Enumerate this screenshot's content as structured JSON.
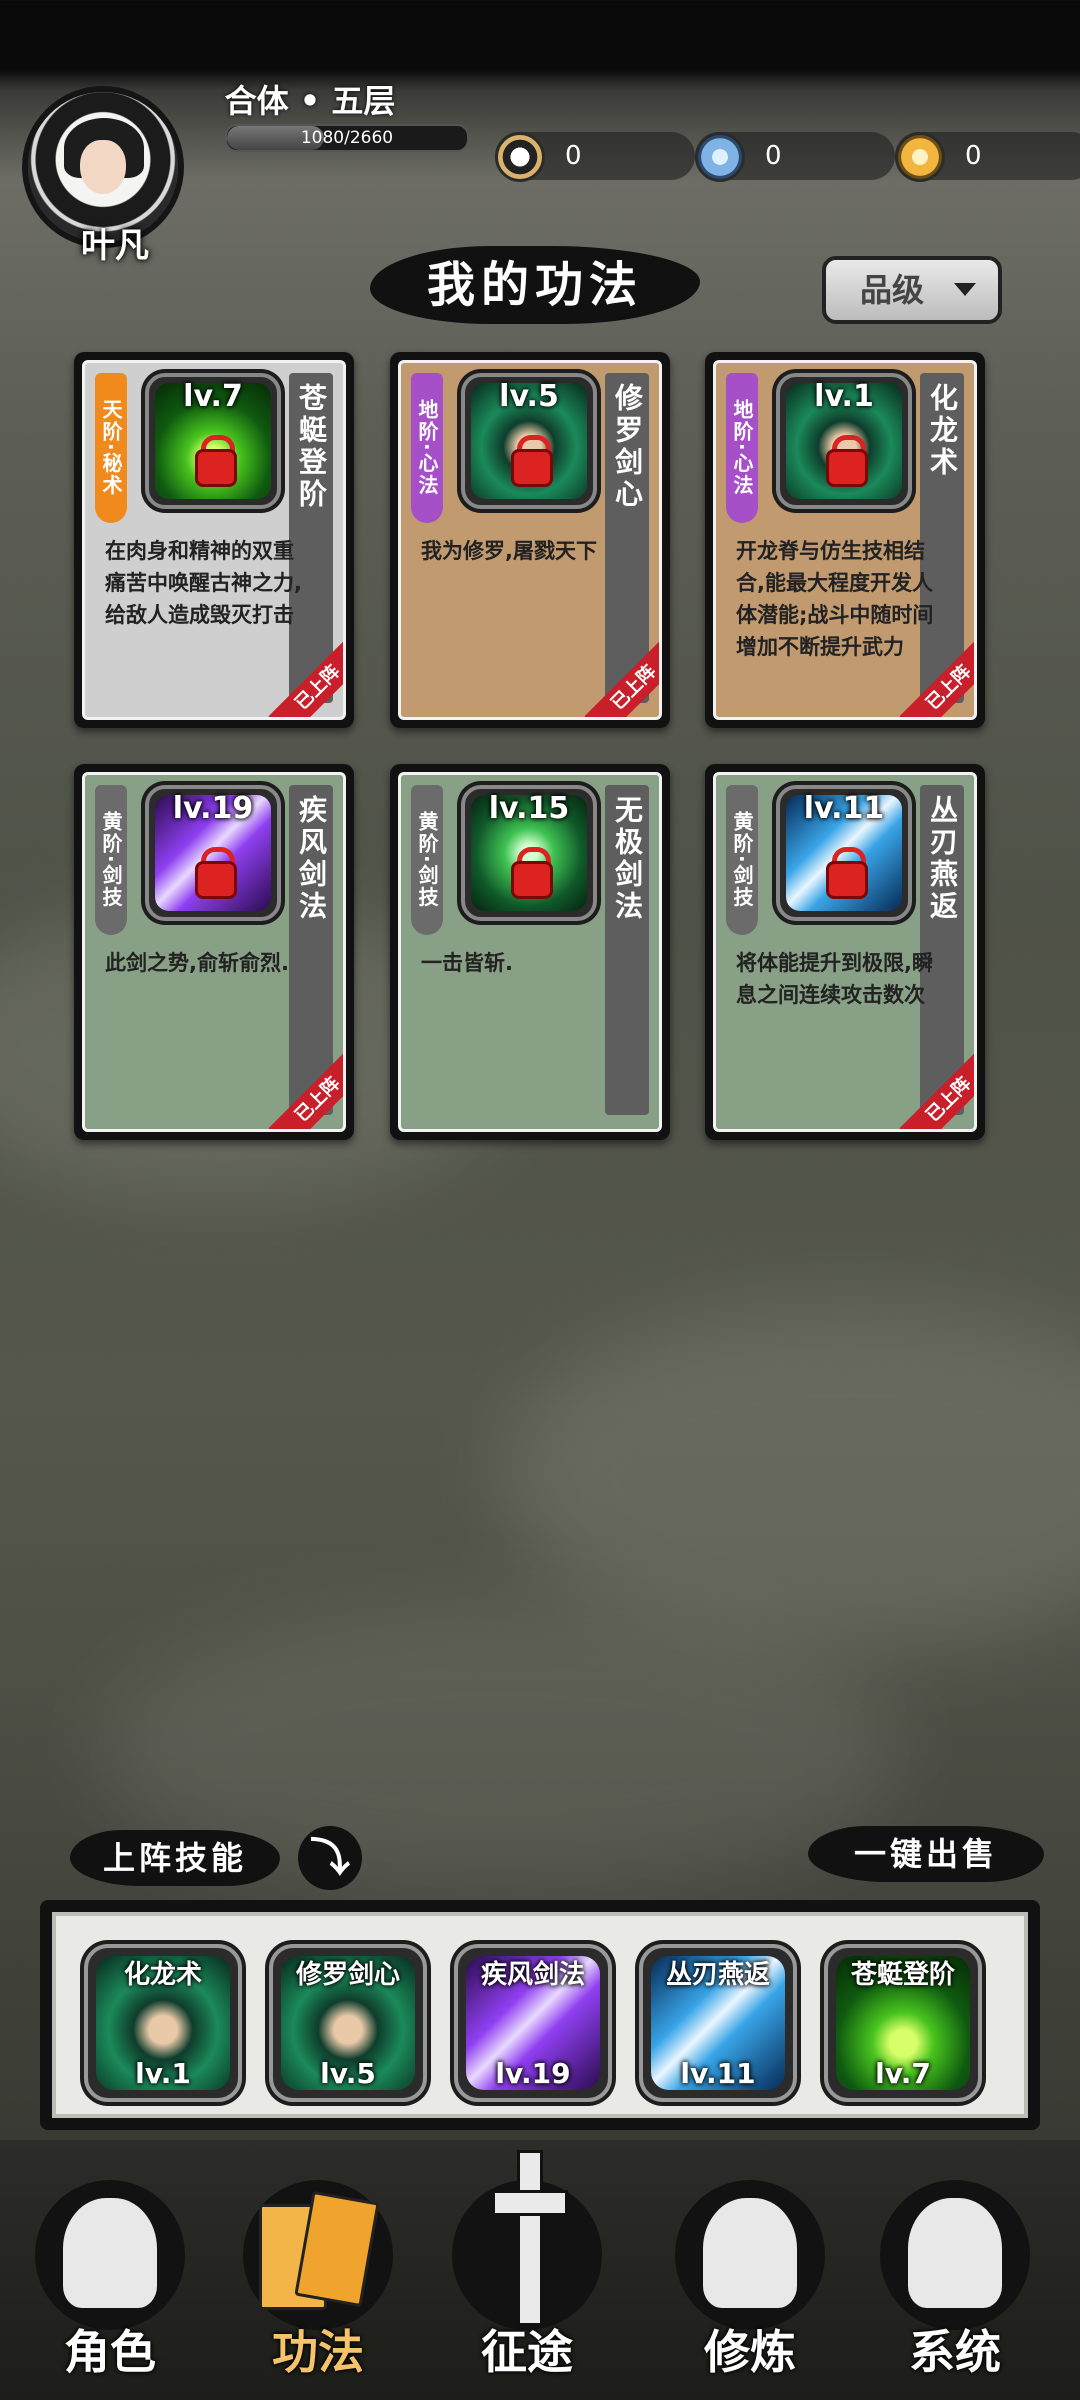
{
  "player": {
    "name": "叶凡",
    "realm": "合体 • 五层",
    "exp_text": "1080/2660",
    "exp_current": 1080,
    "exp_max": 2660
  },
  "resources": [
    {
      "icon": "yin-yang-icon",
      "value": "0",
      "color": "#d9b36a"
    },
    {
      "icon": "crystal-icon",
      "value": "0",
      "color": "#7fb3e6"
    },
    {
      "icon": "lightning-icon",
      "value": "0",
      "color": "#f2b640"
    }
  ],
  "title": "我的功法",
  "sort_button": {
    "label": "品级"
  },
  "cards": [
    {
      "grade": "天阶·秘术",
      "grade_color": "#f08a1c",
      "level": "lv.7",
      "name": "苍蜓登阶",
      "desc": "在肉身和精神的双重痛苦中唤醒古神之力,给敌人造成毁灭打击",
      "equipped": "已上阵",
      "bg": "gray",
      "art": "green-fire"
    },
    {
      "grade": "地阶·心法",
      "grade_color": "#a54fc9",
      "level": "lv.5",
      "name": "修罗剑心",
      "desc": "我为修罗,屠戮天下",
      "equipped": "已上阵",
      "bg": "tan",
      "art": "hooded"
    },
    {
      "grade": "地阶·心法",
      "grade_color": "#a54fc9",
      "level": "lv.1",
      "name": "化龙术",
      "desc": "开龙脊与仿生技相结合,能最大程度开发人体潜能;战斗中随时间增加不断提升武力",
      "equipped": "已上阵",
      "bg": "tan",
      "art": "hooded"
    },
    {
      "grade": "黄阶·剑技",
      "grade_color": "#6b6b6b",
      "level": "lv.19",
      "name": "疾风剑法",
      "desc": "此剑之势,俞斩俞烈.",
      "equipped": "已上阵",
      "bg": "green",
      "art": "purple-slash"
    },
    {
      "grade": "黄阶·剑技",
      "grade_color": "#6b6b6b",
      "level": "lv.15",
      "name": "无极剑法",
      "desc": "一击皆斩.",
      "equipped": "",
      "bg": "green",
      "art": "green-burst"
    },
    {
      "grade": "黄阶·剑技",
      "grade_color": "#6b6b6b",
      "level": "lv.11",
      "name": "丛刃燕返",
      "desc": "将体能提升到极限,瞬息之间连续攻击数次",
      "equipped": "已上阵",
      "bg": "green",
      "art": "blue-slash"
    }
  ],
  "equipped_section": {
    "label": "上阵技能",
    "sell_label": "一键出售"
  },
  "slots": [
    {
      "name": "化龙术",
      "level": "lv.1",
      "art": "hooded"
    },
    {
      "name": "修罗剑心",
      "level": "lv.5",
      "art": "hooded"
    },
    {
      "name": "疾风剑法",
      "level": "lv.19",
      "art": "purple-slash"
    },
    {
      "name": "丛刃燕返",
      "level": "lv.11",
      "art": "blue-slash"
    },
    {
      "name": "苍蜓登阶",
      "level": "lv.7",
      "art": "green-fire"
    }
  ],
  "nav": [
    {
      "label": "角色",
      "icon": "hooded-figure-icon",
      "active": false
    },
    {
      "label": "功法",
      "icon": "book-icon",
      "active": true
    },
    {
      "label": "征途",
      "icon": "sword-emblem-icon",
      "active": false
    },
    {
      "label": "修炼",
      "icon": "meditation-icon",
      "active": false
    },
    {
      "label": "系统",
      "icon": "character-face-icon",
      "active": false
    }
  ]
}
